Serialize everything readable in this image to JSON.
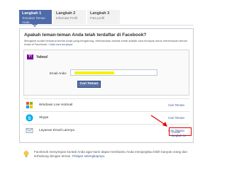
{
  "steps": [
    {
      "title": "Langkah 1",
      "subtitle": "Temukan Teman Anda"
    },
    {
      "title": "Langkah 2",
      "subtitle": "Informasi Profil"
    },
    {
      "title": "Langkah 3",
      "subtitle": "Foto profil"
    }
  ],
  "main": {
    "question": "Apakah teman-teman Anda telah terdaftar di Facebook?",
    "description": "Mengikuti sudah bersama teman Anda yang bergabung. Memasukan alamat email adalah cara tercepat untuk menemukan teman Anda di Facebook.",
    "learn_link": "Lihat cara kerjanya"
  },
  "yahoo": {
    "logo_text": "Y!",
    "name": "Yahoo!",
    "email_label": "Email Anda:",
    "email_value": "",
    "button": "Cari Teman"
  },
  "providers": [
    {
      "name": "Windows Live Hotmail",
      "link": "Cari Teman",
      "icon": "hotmail-icon"
    },
    {
      "name": "Skype",
      "link": "Cari Teman",
      "icon": "skype-icon"
    },
    {
      "name": "Layanan Email Lainnya",
      "link": "Cari Teman",
      "icon": "email-icon"
    }
  ],
  "skip_link": "Lewati langkah ini",
  "footer": {
    "text": "Facebook menyimpan kontak Anda agar kami dapat membantu Anda menjangkau lebih banyak orang dan terhubung dengan teman.",
    "link": "Pelajari selengkapnya."
  },
  "colors": {
    "brand": "#3b5998",
    "active_step": "#4e6aa8",
    "highlight": "#f4f200",
    "annotation": "#e60000"
  }
}
